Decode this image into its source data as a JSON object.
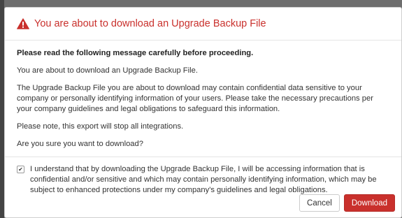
{
  "dialog": {
    "title": "You are about to download an Upgrade Backup File",
    "title_color": "#c9302c",
    "icon": "warning-triangle-icon",
    "intro": "Please read the following message carefully before proceeding.",
    "paragraphs": [
      "You are about to download an Upgrade Backup File.",
      "The Upgrade Backup File you are about to download may contain confidential data sensitive to your company or personally identifying information of your users. Please take the necessary precautions per your company guidelines and legal obligations to safeguard this information.",
      "Please note, this export will stop all integrations.",
      "Are you sure you want to download?"
    ],
    "consent": {
      "checked": true,
      "label": "I understand that by downloading the Upgrade Backup File, I will be accessing information that is confidential and/or sensitive and which may contain personally identifying information, which may be subject to enhanced protections under my company's guidelines and legal obligations."
    },
    "buttons": {
      "cancel": "Cancel",
      "download": "Download",
      "download_color": "#c9302c"
    }
  }
}
